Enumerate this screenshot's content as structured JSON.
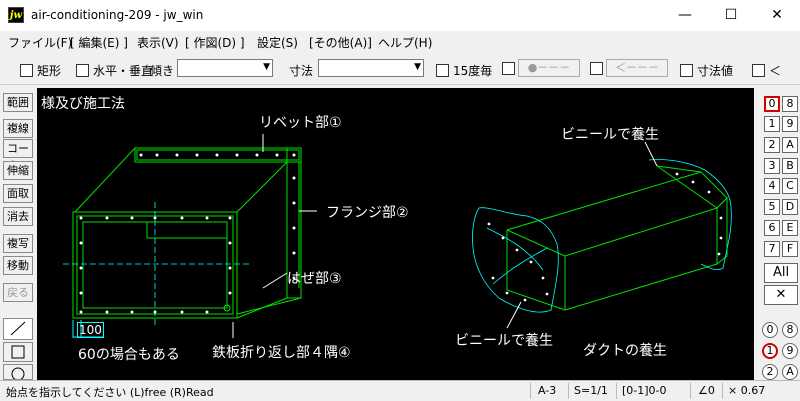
{
  "window": {
    "title": "air-conditioning-209 - jw_win",
    "app_icon": "jw",
    "minimize": "—",
    "maximize": "☐",
    "close": "✕"
  },
  "menu": [
    "ファイル(F)",
    "[ 編集(E) ]",
    "表示(V)",
    "[ 作図(D) ]",
    "設定(S)",
    "[その他(A)]",
    "ヘルプ(H)"
  ],
  "toolbar": {
    "rect_label": "矩形",
    "hv_label": "水平・垂直",
    "tilt_label": "傾き",
    "tilt_value": "",
    "dim_label": "寸法",
    "dim_value": "",
    "deg15_label": "15度毎",
    "line_style_label": "●－－－",
    "arrow_label": "＜－－－",
    "dimval_label": "寸法値",
    "lt_label": "＜"
  },
  "left_tools": [
    "範囲",
    "複線",
    "コーナー",
    "伸縮",
    "面取",
    "消去",
    "複写",
    "移動",
    "戻る"
  ],
  "canvas": {
    "heading": "様及び施工法",
    "rivet_label": "リベット部①",
    "flange_label": "フランジ部②",
    "seam_label": "はぜ部③",
    "corner_label": "鉄板折り返し部４隅④",
    "dim_value": "100",
    "note": "60の場合もある",
    "vinyl_top_label": "ビニールで養生",
    "vinyl_bottom_label": "ビニールで養生",
    "curing_label": "ダクトの養生"
  },
  "layers_left": [
    "0",
    "1",
    "2",
    "3",
    "4",
    "5",
    "6",
    "7"
  ],
  "layers_right": [
    "8",
    "9",
    "A",
    "B",
    "C",
    "D",
    "E",
    "F"
  ],
  "layer_all": "All",
  "layer_x": "✕",
  "groups_left": [
    "0",
    "1",
    "2"
  ],
  "groups_right": [
    "8",
    "9",
    "A"
  ],
  "status": {
    "prompt": "始点を指示してください (L)free (R)Read",
    "paper": "A-3",
    "scale": "S=1/1",
    "layer": "[0-1]0-0",
    "angle": "∠0",
    "zoom": "× 0.67"
  },
  "colors": {
    "canvas_bg": "#000000",
    "duct_line": "#00e000",
    "dim_line": "#00ffff",
    "label_text": "#ffffff",
    "active_layer_border": "#d00000"
  }
}
